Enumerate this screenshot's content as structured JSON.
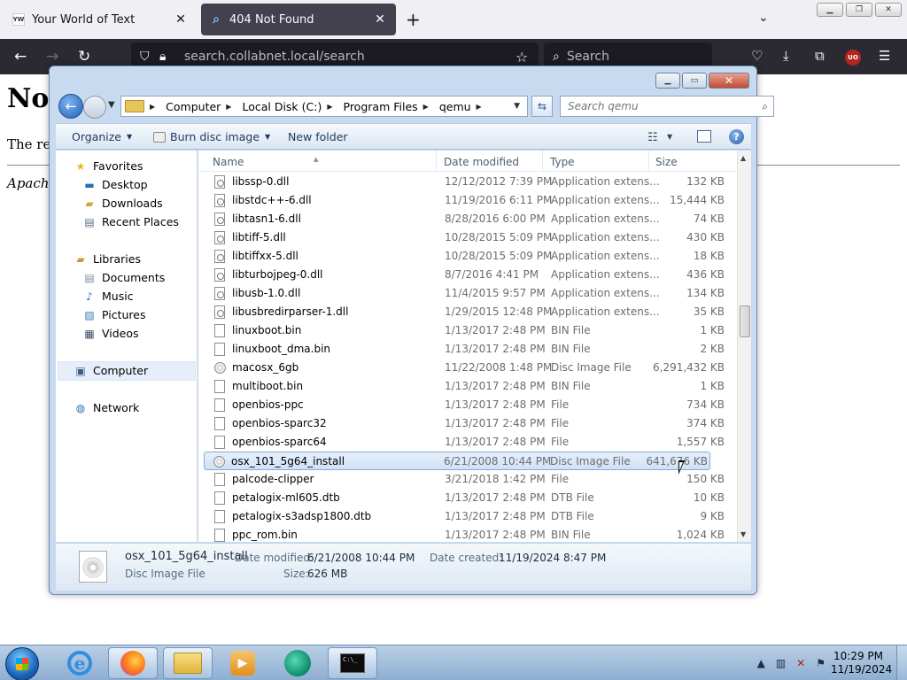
{
  "browser": {
    "tabs": [
      {
        "title": "Your World of Text",
        "favicon": "YW"
      },
      {
        "title": "404 Not Found",
        "favicon": "search-icon"
      }
    ],
    "url": "search.collabnet.local/search",
    "search_placeholder": "Search"
  },
  "webpage": {
    "heading": "Not",
    "paragraph": "The req",
    "address": "Apache"
  },
  "explorer": {
    "breadcrumbs": [
      "Computer",
      "Local Disk (C:)",
      "Program Files",
      "qemu"
    ],
    "search_placeholder": "Search qemu",
    "toolbar": {
      "organize": "Organize",
      "burn": "Burn disc image",
      "new_folder": "New folder"
    },
    "nav": {
      "favorites": "Favorites",
      "desktop": "Desktop",
      "downloads": "Downloads",
      "recent_places": "Recent Places",
      "libraries": "Libraries",
      "documents": "Documents",
      "music": "Music",
      "pictures": "Pictures",
      "videos": "Videos",
      "computer": "Computer",
      "network": "Network"
    },
    "columns": {
      "name": "Name",
      "date": "Date modified",
      "type": "Type",
      "size": "Size"
    },
    "files": [
      {
        "name": "libssp-0.dll",
        "date": "12/12/2012 7:39 PM",
        "type": "Application extens...",
        "size": "132 KB",
        "icon": "dll"
      },
      {
        "name": "libstdc++-6.dll",
        "date": "11/19/2016 6:11 PM",
        "type": "Application extens...",
        "size": "15,444 KB",
        "icon": "dll"
      },
      {
        "name": "libtasn1-6.dll",
        "date": "8/28/2016 6:00 PM",
        "type": "Application extens...",
        "size": "74 KB",
        "icon": "dll"
      },
      {
        "name": "libtiff-5.dll",
        "date": "10/28/2015 5:09 PM",
        "type": "Application extens...",
        "size": "430 KB",
        "icon": "dll"
      },
      {
        "name": "libtiffxx-5.dll",
        "date": "10/28/2015 5:09 PM",
        "type": "Application extens...",
        "size": "18 KB",
        "icon": "dll"
      },
      {
        "name": "libturbojpeg-0.dll",
        "date": "8/7/2016 4:41 PM",
        "type": "Application extens...",
        "size": "436 KB",
        "icon": "dll"
      },
      {
        "name": "libusb-1.0.dll",
        "date": "11/4/2015 9:57 PM",
        "type": "Application extens...",
        "size": "134 KB",
        "icon": "dll"
      },
      {
        "name": "libusbredirparser-1.dll",
        "date": "1/29/2015 12:48 PM",
        "type": "Application extens...",
        "size": "35 KB",
        "icon": "dll"
      },
      {
        "name": "linuxboot.bin",
        "date": "1/13/2017 2:48 PM",
        "type": "BIN File",
        "size": "1 KB",
        "icon": "file"
      },
      {
        "name": "linuxboot_dma.bin",
        "date": "1/13/2017 2:48 PM",
        "type": "BIN File",
        "size": "2 KB",
        "icon": "file"
      },
      {
        "name": "macosx_6gb",
        "date": "11/22/2008 1:48 PM",
        "type": "Disc Image File",
        "size": "6,291,432 KB",
        "icon": "disc"
      },
      {
        "name": "multiboot.bin",
        "date": "1/13/2017 2:48 PM",
        "type": "BIN File",
        "size": "1 KB",
        "icon": "file"
      },
      {
        "name": "openbios-ppc",
        "date": "1/13/2017 2:48 PM",
        "type": "File",
        "size": "734 KB",
        "icon": "file"
      },
      {
        "name": "openbios-sparc32",
        "date": "1/13/2017 2:48 PM",
        "type": "File",
        "size": "374 KB",
        "icon": "file"
      },
      {
        "name": "openbios-sparc64",
        "date": "1/13/2017 2:48 PM",
        "type": "File",
        "size": "1,557 KB",
        "icon": "file"
      },
      {
        "name": "osx_101_5g64_install",
        "date": "6/21/2008 10:44 PM",
        "type": "Disc Image File",
        "size": "641,676 KB",
        "icon": "disc",
        "selected": true
      },
      {
        "name": "palcode-clipper",
        "date": "3/21/2018 1:42 PM",
        "type": "File",
        "size": "150 KB",
        "icon": "file"
      },
      {
        "name": "petalogix-ml605.dtb",
        "date": "1/13/2017 2:48 PM",
        "type": "DTB File",
        "size": "10 KB",
        "icon": "file"
      },
      {
        "name": "petalogix-s3adsp1800.dtb",
        "date": "1/13/2017 2:48 PM",
        "type": "DTB File",
        "size": "9 KB",
        "icon": "file"
      },
      {
        "name": "ppc_rom.bin",
        "date": "1/13/2017 2:48 PM",
        "type": "BIN File",
        "size": "1,024 KB",
        "icon": "file"
      }
    ],
    "details": {
      "name": "osx_101_5g64_install",
      "type": "Disc Image File",
      "modified_label": "Date modified:",
      "modified": "6/21/2008 10:44 PM",
      "created_label": "Date created:",
      "created": "11/19/2024 8:47 PM",
      "size_label": "Size:",
      "size": "626 MB"
    }
  },
  "taskbar": {
    "time": "10:29 PM",
    "date": "11/19/2024"
  }
}
